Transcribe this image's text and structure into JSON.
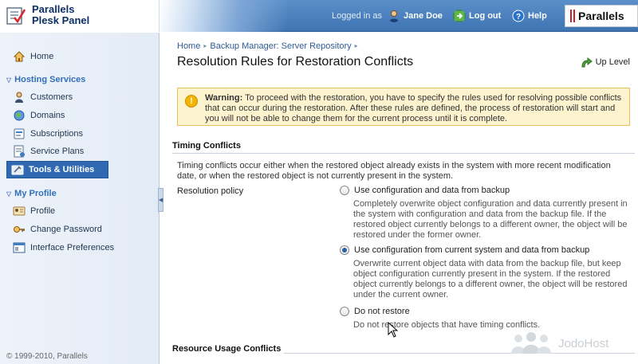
{
  "header": {
    "logo_line1": "Parallels",
    "logo_line2": "Plesk Panel",
    "logged_in_as": "Logged in as",
    "user_name": "Jane Doe",
    "logout_label": "Log out",
    "help_label": "Help",
    "brand": "Parallels"
  },
  "sidebar": {
    "home": "Home",
    "hosting_services_title": "Hosting Services",
    "hosting_items": [
      "Customers",
      "Domains",
      "Subscriptions",
      "Service Plans",
      "Tools & Utilities"
    ],
    "my_profile_title": "My Profile",
    "profile_items": [
      "Profile",
      "Change Password",
      "Interface Preferences"
    ],
    "copyright": "© 1999-2010, Parallels"
  },
  "breadcrumb": [
    "Home",
    "Backup Manager: Server Repository"
  ],
  "page_title": "Resolution Rules for Restoration Conflicts",
  "up_level": "Up Level",
  "warning": {
    "label": "Warning:",
    "text": "To proceed with the restoration, you have to specify the rules used for resolving possible conflicts that can occur during the restoration. After these rules are defined, the process of restoration will start and you will not be able to change them for the current process until it is complete."
  },
  "timing": {
    "title": "Timing Conflicts",
    "description": "Timing conflicts occur either when the restored object already exists in the system with more recent modification date, or when the restored object is not currently present in the system.",
    "field_label": "Resolution policy",
    "options": [
      {
        "label": "Use configuration and data from backup",
        "desc": "Completely overwrite object configuration and data currently present in the system with configuration and data from the backup file. If the restored object currently belongs to a different owner, the object will be restored under the former owner.",
        "selected": false
      },
      {
        "label": "Use configuration from current system and data from backup",
        "desc": "Overwrite current object data with data from the backup file, but keep object configuration currently present in the system. If the restored object currently belongs to a different owner, the object will be restored under the current owner.",
        "selected": true
      },
      {
        "label": "Do not restore",
        "desc": "Do not restore objects that have timing conflicts.",
        "selected": false
      }
    ]
  },
  "resource": {
    "title": "Resource Usage Conflicts"
  },
  "watermark": "JodoHost",
  "colors": {
    "header_blue": "#4a82c0",
    "active_nav": "#2e69b1",
    "warning_bg": "#fdf3cf",
    "section_link": "#3170b8"
  }
}
